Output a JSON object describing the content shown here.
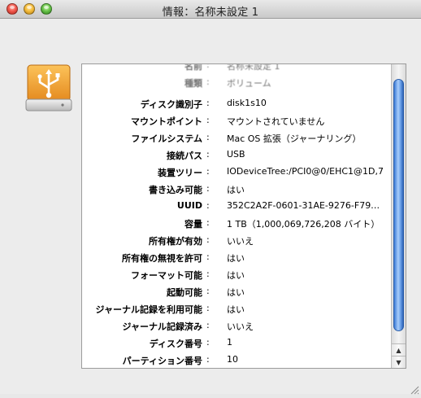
{
  "window": {
    "title": "情報：名称未設定 1"
  },
  "drive_icon": {
    "name": "usb-drive-icon"
  },
  "rows": [
    {
      "label": "名前",
      "colon": ":",
      "value": "名称未設定 1",
      "faded": true
    },
    {
      "label": "種類",
      "colon": ":",
      "value": "ボリューム",
      "faded": true
    },
    {
      "label": "ディスク識別子",
      "colon": ":",
      "value": "disk1s10"
    },
    {
      "label": "マウントポイント",
      "colon": ":",
      "value": "マウントされていません"
    },
    {
      "label": "ファイルシステム",
      "colon": ":",
      "value": "Mac OS 拡張（ジャーナリング）"
    },
    {
      "label": "接続パス",
      "colon": ":",
      "value": "USB"
    },
    {
      "label": "装置ツリー",
      "colon": ":",
      "value": "IODeviceTree:/PCI0@0/EHC1@1D,7"
    },
    {
      "label": "書き込み可能",
      "colon": ":",
      "value": "はい"
    },
    {
      "label": "UUID",
      "colon": ":",
      "value": "352C2A2F-0601-31AE-9276-F79…"
    },
    {
      "label": "容量",
      "colon": ":",
      "value": "1 TB（1,000,069,726,208 バイト）"
    },
    {
      "label": "所有権が有効",
      "colon": ":",
      "value": "いいえ"
    },
    {
      "label": "所有権の無視を許可",
      "colon": ":",
      "value": "はい"
    },
    {
      "label": "フォーマット可能",
      "colon": ":",
      "value": "はい"
    },
    {
      "label": "起動可能",
      "colon": ":",
      "value": "はい"
    },
    {
      "label": "ジャーナル記録を利用可能",
      "colon": ":",
      "value": "はい"
    },
    {
      "label": "ジャーナル記録済み",
      "colon": ":",
      "value": "いいえ"
    },
    {
      "label": "ディスク番号",
      "colon": ":",
      "value": "1"
    },
    {
      "label": "パーティション番号",
      "colon": ":",
      "value": "10"
    }
  ],
  "scrollbar": {
    "up_glyph": "▲",
    "down_glyph": "▼"
  },
  "colors": {
    "accent": "#3b7ad6",
    "drive_orange": "#f0a23a"
  }
}
